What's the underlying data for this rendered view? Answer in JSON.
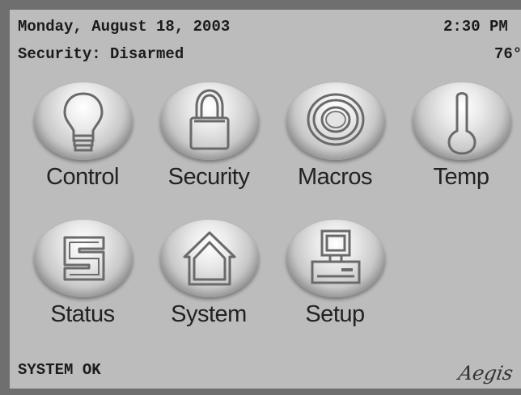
{
  "header": {
    "date": "Monday, August 18, 2003",
    "time": "2:30 PM",
    "security_status": "Security: Disarmed",
    "temperature": "76°"
  },
  "buttons": [
    {
      "label": "Control",
      "icon": "lightbulb-icon"
    },
    {
      "label": "Security",
      "icon": "padlock-icon"
    },
    {
      "label": "Macros",
      "icon": "target-icon"
    },
    {
      "label": "Temp",
      "icon": "thermometer-icon"
    },
    {
      "label": "Status",
      "icon": "status-s-icon"
    },
    {
      "label": "System",
      "icon": "house-icon"
    },
    {
      "label": "Setup",
      "icon": "computer-icon"
    }
  ],
  "footer": {
    "status": "SYSTEM OK",
    "logo": "Aegis"
  }
}
